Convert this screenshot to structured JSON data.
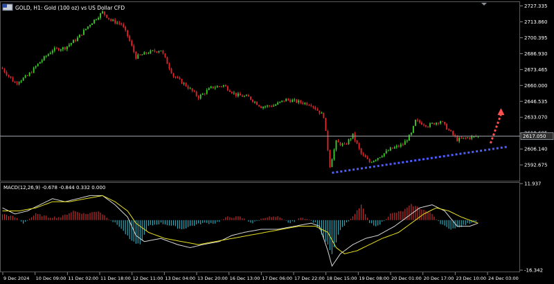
{
  "window": {
    "title": "GOLD, H1:  Gold (100 oz) vs US Dollar CFD",
    "scroll_marker_icon": "triangle-down-icon"
  },
  "price_panel": {
    "current_price": "2617.050"
  },
  "macd": {
    "label": "MACD(12,26,9) -0.678 -0.844 0.332 0.000"
  },
  "colors": {
    "background": "#000000",
    "bull": "#3cd12a",
    "bear": "#e8242c",
    "grid_line": "#9aa0a6",
    "trendline": "#4c5cff",
    "projection_arrow": "#ff4f4f",
    "macd_line": "#d8d8d8",
    "signal_line": "#e8e020",
    "hist_pos": "#c0302f",
    "hist_neg": "#2aa7b8"
  },
  "chart_data": [
    {
      "type": "candlestick",
      "title": "GOLD, H1:  Gold (100 oz) vs US Dollar CFD",
      "ylim": [
        2581,
        2730
      ],
      "y_ticks": [
        "2727.335",
        "2713.860",
        "2700.395",
        "2686.930",
        "2673.465",
        "2660.000",
        "2646.535",
        "2633.070",
        "2619.605",
        "2606.140",
        "2592.675"
      ],
      "x_ticks": [
        "9 Dec 2024",
        "10 Dec 09:00",
        "11 Dec 02:00",
        "11 Dec 18:00",
        "12 Dec 11:00",
        "13 Dec 04:00",
        "13 Dec 20:00",
        "16 Dec 13:00",
        "17 Dec 06:00",
        "17 Dec 22:00",
        "18 Dec 15:00",
        "19 Dec 08:00",
        "20 Dec 01:00",
        "20 Dec 17:00",
        "23 Dec 10:00",
        "24 Dec 03:00"
      ],
      "close_keypoints": [
        [
          0,
          2674
        ],
        [
          6,
          2662
        ],
        [
          12,
          2668
        ],
        [
          18,
          2680
        ],
        [
          24,
          2690
        ],
        [
          30,
          2692
        ],
        [
          36,
          2700
        ],
        [
          42,
          2712
        ],
        [
          48,
          2722
        ],
        [
          52,
          2715
        ],
        [
          57,
          2712
        ],
        [
          60,
          2702
        ],
        [
          64,
          2684
        ],
        [
          70,
          2688
        ],
        [
          76,
          2690
        ],
        [
          82,
          2668
        ],
        [
          88,
          2660
        ],
        [
          94,
          2650
        ],
        [
          100,
          2658
        ],
        [
          106,
          2660
        ],
        [
          112,
          2652
        ],
        [
          118,
          2650
        ],
        [
          124,
          2642
        ],
        [
          130,
          2643
        ],
        [
          136,
          2648
        ],
        [
          142,
          2646
        ],
        [
          148,
          2644
        ],
        [
          154,
          2634
        ],
        [
          157,
          2592
        ],
        [
          160,
          2612
        ],
        [
          164,
          2609
        ],
        [
          168,
          2618
        ],
        [
          172,
          2602
        ],
        [
          176,
          2595
        ],
        [
          180,
          2599
        ],
        [
          186,
          2606
        ],
        [
          192,
          2610
        ],
        [
          196,
          2619
        ],
        [
          198,
          2630
        ],
        [
          204,
          2626
        ],
        [
          210,
          2630
        ],
        [
          214,
          2622
        ],
        [
          218,
          2614
        ],
        [
          224,
          2616
        ],
        [
          228,
          2617
        ]
      ],
      "current_price": 2617.05,
      "trendline": {
        "from": [
          158,
          2586
        ],
        "to": [
          242,
          2608
        ]
      },
      "projection_arrow": {
        "from": [
          234,
          2611
        ],
        "to": [
          239,
          2639
        ]
      }
    },
    {
      "type": "macd",
      "ylim": [
        -16.342,
        11.937
      ],
      "y_ticks": [
        "11.937",
        "-16.342"
      ],
      "histogram_keypoints": [
        [
          0,
          2
        ],
        [
          6,
          1
        ],
        [
          10,
          -1
        ],
        [
          16,
          2
        ],
        [
          22,
          1
        ],
        [
          28,
          1
        ],
        [
          34,
          3
        ],
        [
          40,
          2
        ],
        [
          46,
          3
        ],
        [
          50,
          1
        ],
        [
          56,
          -2
        ],
        [
          62,
          -7
        ],
        [
          66,
          -8
        ],
        [
          70,
          -2
        ],
        [
          76,
          -1
        ],
        [
          82,
          -2
        ],
        [
          86,
          -3
        ],
        [
          90,
          -2
        ],
        [
          96,
          -1
        ],
        [
          102,
          -1
        ],
        [
          108,
          1
        ],
        [
          114,
          1
        ],
        [
          120,
          -1
        ],
        [
          126,
          1
        ],
        [
          132,
          1
        ],
        [
          138,
          -1
        ],
        [
          144,
          1
        ],
        [
          150,
          -1
        ],
        [
          156,
          -8
        ],
        [
          158,
          -11
        ],
        [
          162,
          -3
        ],
        [
          168,
          1
        ],
        [
          172,
          5
        ],
        [
          176,
          -1
        ],
        [
          180,
          -2
        ],
        [
          186,
          2
        ],
        [
          192,
          3
        ],
        [
          196,
          5
        ],
        [
          200,
          4
        ],
        [
          206,
          2
        ],
        [
          210,
          -1
        ],
        [
          214,
          -3
        ],
        [
          220,
          -2
        ],
        [
          228,
          0
        ]
      ],
      "macd_keypoints": [
        [
          0,
          4
        ],
        [
          6,
          2
        ],
        [
          12,
          3
        ],
        [
          18,
          5
        ],
        [
          24,
          7
        ],
        [
          30,
          6
        ],
        [
          36,
          7
        ],
        [
          42,
          8
        ],
        [
          48,
          8
        ],
        [
          54,
          5
        ],
        [
          60,
          1
        ],
        [
          64,
          -5
        ],
        [
          68,
          -7
        ],
        [
          76,
          -6
        ],
        [
          84,
          -8
        ],
        [
          90,
          -9
        ],
        [
          96,
          -8
        ],
        [
          104,
          -7
        ],
        [
          110,
          -5
        ],
        [
          116,
          -4
        ],
        [
          124,
          -3
        ],
        [
          132,
          -3
        ],
        [
          140,
          -2
        ],
        [
          148,
          -1
        ],
        [
          152,
          -2
        ],
        [
          156,
          -10
        ],
        [
          158,
          -15
        ],
        [
          162,
          -11
        ],
        [
          168,
          -8
        ],
        [
          174,
          -6
        ],
        [
          180,
          -5
        ],
        [
          188,
          -2
        ],
        [
          194,
          1
        ],
        [
          200,
          4
        ],
        [
          206,
          5
        ],
        [
          212,
          3
        ],
        [
          218,
          -2
        ],
        [
          224,
          -2
        ],
        [
          228,
          -1
        ]
      ],
      "signal_keypoints": [
        [
          0,
          3
        ],
        [
          8,
          3
        ],
        [
          16,
          4
        ],
        [
          24,
          6
        ],
        [
          32,
          6
        ],
        [
          40,
          7
        ],
        [
          48,
          8
        ],
        [
          54,
          6
        ],
        [
          60,
          3
        ],
        [
          64,
          -1
        ],
        [
          70,
          -4
        ],
        [
          78,
          -6
        ],
        [
          86,
          -7
        ],
        [
          94,
          -8
        ],
        [
          102,
          -7
        ],
        [
          110,
          -6
        ],
        [
          118,
          -5
        ],
        [
          126,
          -4
        ],
        [
          134,
          -3
        ],
        [
          142,
          -2
        ],
        [
          150,
          -2
        ],
        [
          156,
          -4
        ],
        [
          160,
          -9
        ],
        [
          164,
          -11
        ],
        [
          170,
          -10
        ],
        [
          176,
          -8
        ],
        [
          182,
          -6
        ],
        [
          190,
          -4
        ],
        [
          196,
          -1
        ],
        [
          202,
          2
        ],
        [
          208,
          4
        ],
        [
          214,
          3
        ],
        [
          220,
          1
        ],
        [
          228,
          -1
        ]
      ]
    }
  ]
}
